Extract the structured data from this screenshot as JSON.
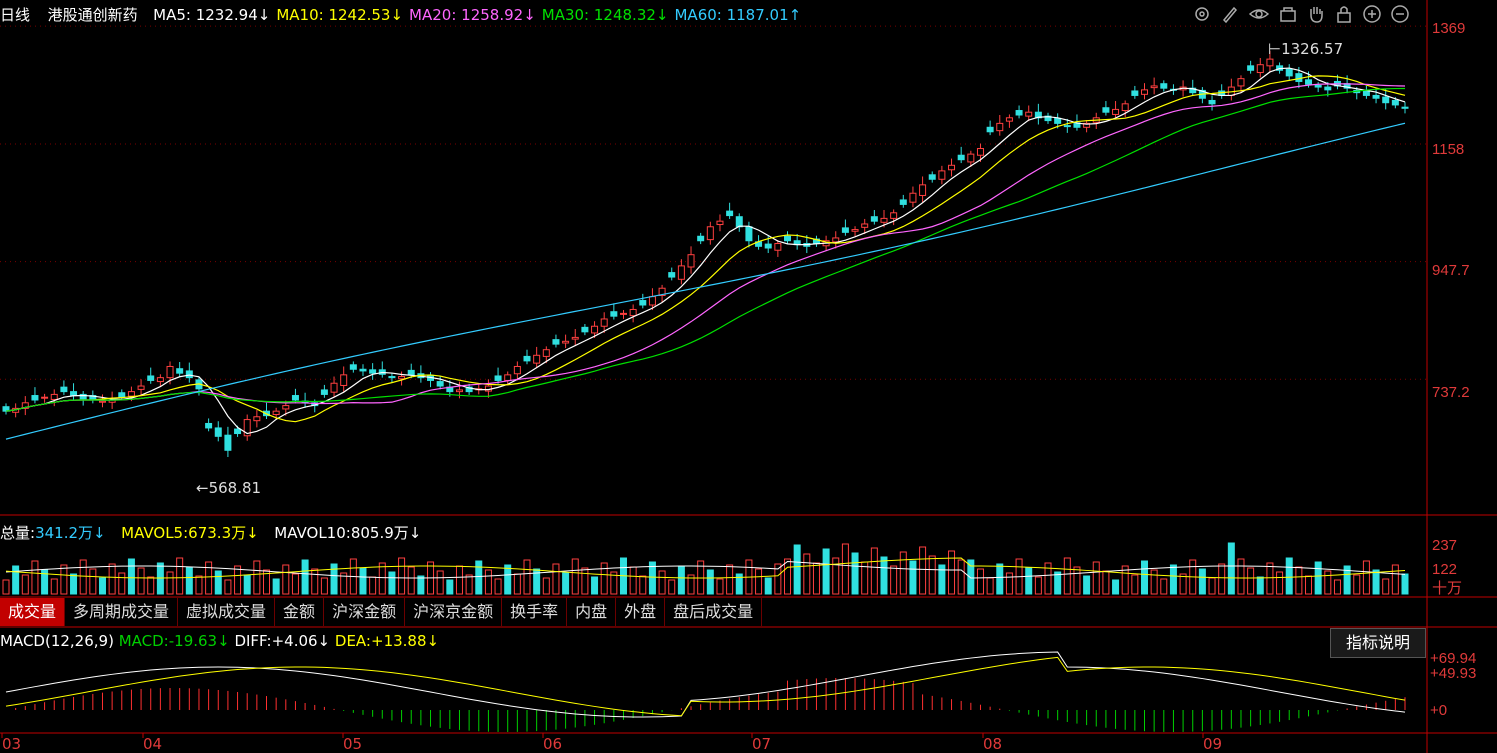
{
  "main_header": {
    "period": "日线",
    "name": "港股通创新药",
    "ma": [
      {
        "label": "MA5:",
        "value": "1232.94",
        "arrow": "↓",
        "color": "#ffffff"
      },
      {
        "label": "MA10:",
        "value": "1242.53",
        "arrow": "↓",
        "color": "#ffff00"
      },
      {
        "label": "MA20:",
        "value": "1258.92",
        "arrow": "↓",
        "color": "#ff66ff"
      },
      {
        "label": "MA30:",
        "value": "1248.32",
        "arrow": "↓",
        "color": "#00e000"
      },
      {
        "label": "MA60:",
        "value": "1187.01",
        "arrow": "↑",
        "color": "#33ccff"
      }
    ]
  },
  "toolbar_icons": [
    "settings-icon",
    "pen-icon",
    "eye-icon",
    "bag-icon",
    "hand-icon",
    "lock-icon",
    "zoom-in-icon",
    "zoom-out-icon"
  ],
  "price_axis": {
    "labels": [
      "1369",
      "1158",
      "947.7",
      "737.2"
    ]
  },
  "price_annotations": {
    "high": "1326.57",
    "low": "568.81"
  },
  "volume_header": {
    "total_label": "总量:",
    "total_value": "341.2万",
    "total_arrow": "↓",
    "mavol5_label": "MAVOL5:",
    "mavol5_value": "673.3万",
    "mavol5_arrow": "↓",
    "mavol10_label": "MAVOL10:",
    "mavol10_value": "805.9万",
    "mavol10_arrow": "↓"
  },
  "volume_axis": {
    "labels": [
      "237",
      "122"
    ],
    "unit": "十万"
  },
  "tabs": [
    "成交量",
    "多周期成交量",
    "虚拟成交量",
    "金额",
    "沪深金额",
    "沪深京金额",
    "换手率",
    "内盘",
    "外盘",
    "盘后成交量"
  ],
  "macd_header": {
    "name": "MACD(12,26,9)",
    "macd_label": "MACD:",
    "macd_value": "-19.63",
    "macd_arrow": "↓",
    "diff_label": "DIFF:",
    "diff_value": "+4.06",
    "diff_arrow": "↓",
    "dea_label": "DEA:",
    "dea_value": "+13.88",
    "dea_arrow": "↓"
  },
  "indicator_button": "指标说明",
  "macd_axis": {
    "labels": [
      "+69.94",
      "+49.93",
      "+0"
    ]
  },
  "months": [
    "03",
    "04",
    "05",
    "06",
    "07",
    "08",
    "09"
  ],
  "chart_data": {
    "type": "candlestick",
    "price_axis_ticks": [
      1369,
      1158,
      947.7,
      737.2
    ],
    "annotated_high": 1326.57,
    "annotated_low": 568.81,
    "ma_values": {
      "MA5": 1232.94,
      "MA10": 1242.53,
      "MA20": 1258.92,
      "MA30": 1248.32,
      "MA60": 1187.01
    },
    "closes": [
      680,
      685,
      695,
      700,
      705,
      710,
      715,
      708,
      702,
      700,
      698,
      700,
      705,
      715,
      725,
      735,
      740,
      760,
      748,
      740,
      720,
      650,
      635,
      610,
      640,
      665,
      670,
      672,
      680,
      690,
      700,
      695,
      690,
      710,
      730,
      745,
      755,
      752,
      748,
      746,
      740,
      742,
      745,
      740,
      735,
      725,
      715,
      718,
      715,
      720,
      725,
      735,
      745,
      760,
      770,
      780,
      790,
      800,
      805,
      812,
      822,
      832,
      845,
      850,
      855,
      862,
      870,
      885,
      900,
      920,
      940,
      960,
      985,
      1010,
      1020,
      1030,
      1010,
      985,
      975,
      972,
      980,
      985,
      978,
      975,
      980,
      985,
      990,
      1000,
      1005,
      1015,
      1020,
      1025,
      1035,
      1050,
      1070,
      1085,
      1095,
      1110,
      1120,
      1130,
      1140,
      1150,
      1180,
      1195,
      1205,
      1210,
      1215,
      1205,
      1200,
      1195,
      1190,
      1188,
      1195,
      1205,
      1215,
      1220,
      1230,
      1245,
      1255,
      1262,
      1258,
      1255,
      1260,
      1250,
      1240,
      1230,
      1245,
      1260,
      1275,
      1290,
      1300,
      1310,
      1290,
      1280,
      1270,
      1265,
      1260,
      1255,
      1262,
      1258,
      1250,
      1245,
      1240,
      1232,
      1228,
      1222
    ],
    "macd_axis_ticks": [
      69.94,
      49.93,
      0
    ],
    "macd": {
      "MACD": -19.63,
      "DIFF": 4.06,
      "DEA": 13.88
    }
  }
}
